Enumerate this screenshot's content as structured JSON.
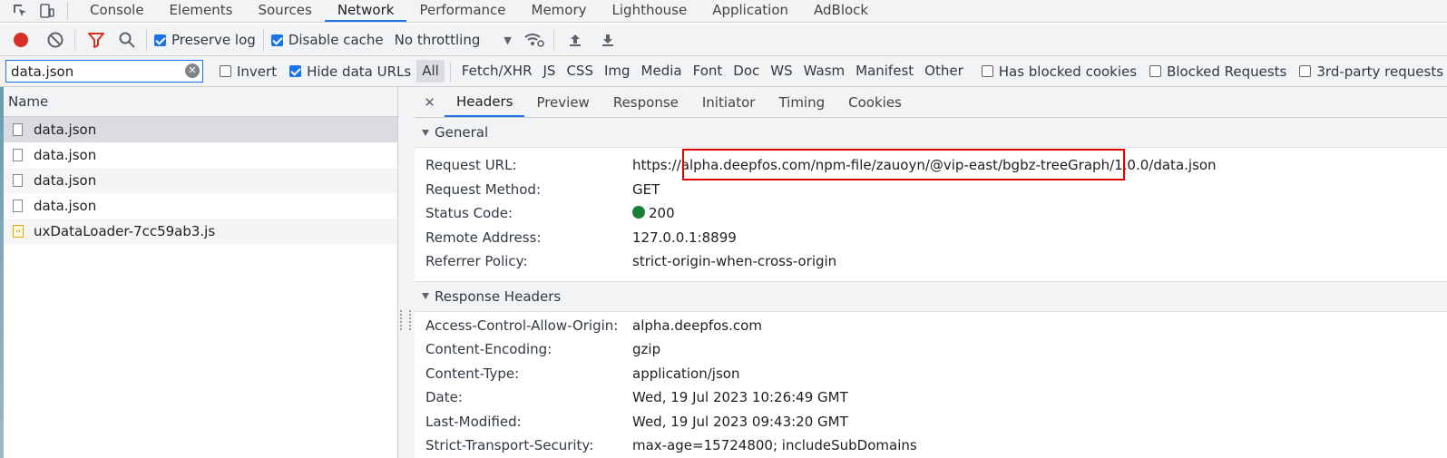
{
  "panel_tabs": [
    "Console",
    "Elements",
    "Sources",
    "Network",
    "Performance",
    "Memory",
    "Lighthouse",
    "Application",
    "AdBlock"
  ],
  "active_panel_tab": "Network",
  "toolbar": {
    "preserve_log_label": "Preserve log",
    "preserve_log_checked": true,
    "disable_cache_label": "Disable cache",
    "disable_cache_checked": true,
    "throttling_value": "No throttling"
  },
  "filter": {
    "value": "data.json",
    "invert_label": "Invert",
    "hide_data_urls_label": "Hide data URLs",
    "types": [
      "All",
      "Fetch/XHR",
      "JS",
      "CSS",
      "Img",
      "Media",
      "Font",
      "Doc",
      "WS",
      "Wasm",
      "Manifest",
      "Other"
    ],
    "selected_type": "All",
    "blocked_cookies_label": "Has blocked cookies",
    "blocked_requests_label": "Blocked Requests",
    "third_party_label": "3rd-party requests"
  },
  "request_list": {
    "header": "Name",
    "items": [
      {
        "name": "data.json",
        "kind": "file"
      },
      {
        "name": "data.json",
        "kind": "file"
      },
      {
        "name": "data.json",
        "kind": "file"
      },
      {
        "name": "data.json",
        "kind": "file"
      },
      {
        "name": "uxDataLoader-7cc59ab3.js",
        "kind": "js"
      }
    ]
  },
  "detail_tabs": [
    "Headers",
    "Preview",
    "Response",
    "Initiator",
    "Timing",
    "Cookies"
  ],
  "active_detail_tab": "Headers",
  "general": {
    "title": "General",
    "rows": [
      {
        "key": "Request URL:",
        "value": "https://alpha.deepfos.com/npm-file/zauoyn/@vip-east/bgbz-treeGraph/1.0.0/data.json"
      },
      {
        "key": "Request Method:",
        "value": "GET"
      },
      {
        "key": "Status Code:",
        "value": "200"
      },
      {
        "key": "Remote Address:",
        "value": "127.0.0.1:8899"
      },
      {
        "key": "Referrer Policy:",
        "value": "strict-origin-when-cross-origin"
      }
    ]
  },
  "response_headers": {
    "title": "Response Headers",
    "rows": [
      {
        "key": "Access-Control-Allow-Origin:",
        "value": "alpha.deepfos.com"
      },
      {
        "key": "Content-Encoding:",
        "value": "gzip"
      },
      {
        "key": "Content-Type:",
        "value": "application/json"
      },
      {
        "key": "Date:",
        "value": "Wed, 19 Jul 2023 10:26:49 GMT"
      },
      {
        "key": "Last-Modified:",
        "value": "Wed, 19 Jul 2023 09:43:20 GMT"
      },
      {
        "key": "Strict-Transport-Security:",
        "value": "max-age=15724800; includeSubDomains"
      }
    ]
  },
  "colors": {
    "accent": "#1a73e8",
    "record": "#d93025",
    "status_ok": "#188038",
    "highlight": "#e00000"
  }
}
